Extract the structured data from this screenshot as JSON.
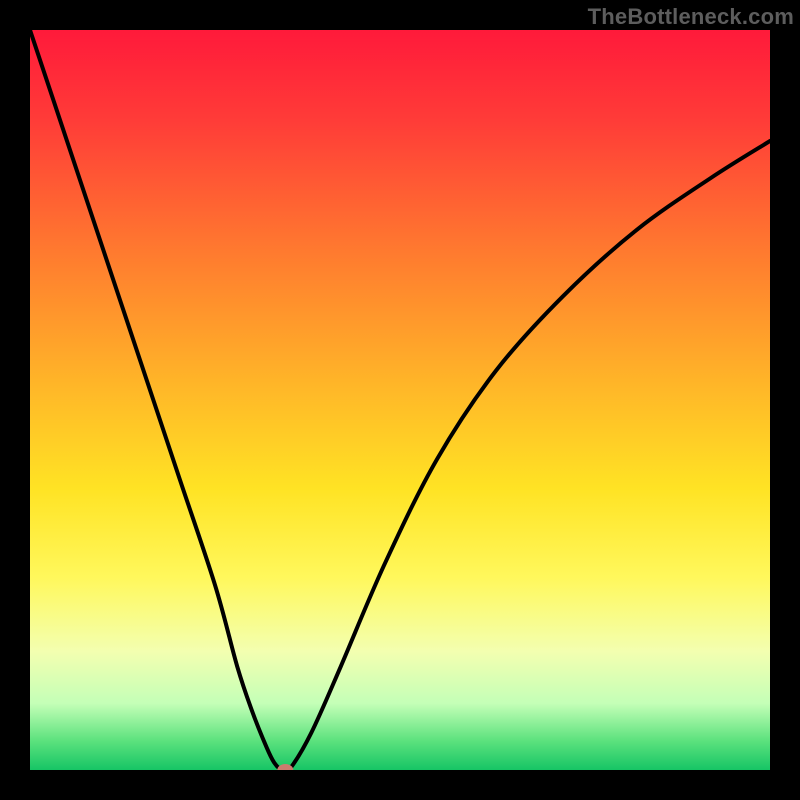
{
  "watermark": "TheBottleneck.com",
  "chart_data": {
    "type": "line",
    "title": "",
    "xlabel": "",
    "ylabel": "",
    "xlim": [
      0,
      100
    ],
    "ylim": [
      0,
      100
    ],
    "background_gradient_stops": [
      {
        "offset": 0,
        "color": "#ff1a3a"
      },
      {
        "offset": 12,
        "color": "#ff3b38"
      },
      {
        "offset": 30,
        "color": "#ff7a2f"
      },
      {
        "offset": 48,
        "color": "#ffb628"
      },
      {
        "offset": 62,
        "color": "#ffe324"
      },
      {
        "offset": 74,
        "color": "#fff85c"
      },
      {
        "offset": 84,
        "color": "#f3ffb0"
      },
      {
        "offset": 91,
        "color": "#c4ffb7"
      },
      {
        "offset": 96,
        "color": "#5de27e"
      },
      {
        "offset": 100,
        "color": "#16c565"
      }
    ],
    "series": [
      {
        "name": "bottleneck-curve",
        "x": [
          0,
          5,
          10,
          15,
          20,
          25,
          28,
          30,
          32,
          33,
          34,
          35,
          38,
          42,
          48,
          55,
          63,
          72,
          82,
          92,
          100
        ],
        "values": [
          100,
          85,
          70,
          55,
          40,
          25,
          14,
          8,
          3,
          1,
          0,
          0,
          5,
          14,
          28,
          42,
          54,
          64,
          73,
          80,
          85
        ]
      }
    ],
    "marker": {
      "x": 34.5,
      "y": 0,
      "color": "#c97c6e"
    },
    "colors": {
      "frame": "#000000",
      "curve": "#000000",
      "marker": "#c97c6e"
    }
  }
}
